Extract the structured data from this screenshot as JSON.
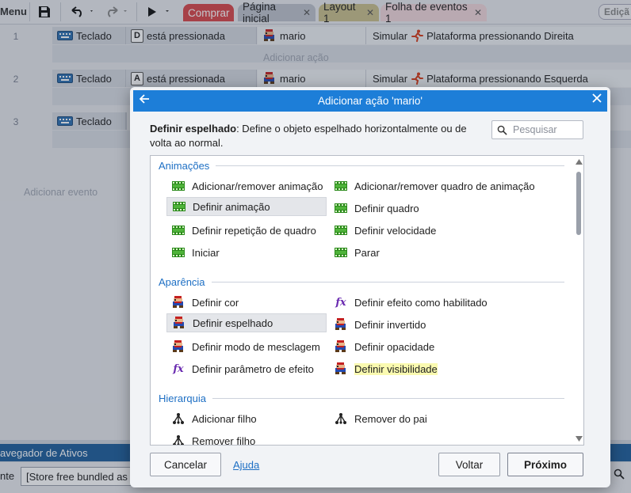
{
  "toolbar": {
    "menu_label": "Menu",
    "tabs": [
      {
        "label": "Comprar",
        "bg": "#d9474a",
        "fg": "#ffffff"
      },
      {
        "label": "Página inicial",
        "bg": "#bec3cc",
        "fg": "#1e1e1e"
      },
      {
        "label": "Layout 1",
        "bg": "#c9bf8c",
        "fg": "#1e1e1e"
      },
      {
        "label": "Folha de eventos 1",
        "bg": "#f1d7db",
        "fg": "#1e1e1e"
      }
    ],
    "edit_label": "Ediçã"
  },
  "events": [
    {
      "num": "1",
      "cond_object": "Teclado",
      "cond_key": "D",
      "cond_text": "está pressionada",
      "act_object": "mario",
      "act_text": "Simular",
      "act_detail": "Plataforma pressionando Direita",
      "add_action": "Adicionar ação"
    },
    {
      "num": "2",
      "cond_object": "Teclado",
      "cond_key": "A",
      "cond_text": "está pressionada",
      "act_object": "mario",
      "act_text": "Simular",
      "act_detail": "Plataforma pressionando Esquerda"
    },
    {
      "num": "3",
      "cond_object": "Teclado"
    }
  ],
  "add_event": "Adicionar evento",
  "bottom": {
    "panel_title": "avegador de Ativos",
    "left_label": "nte",
    "select_value": "[Store free bundled as"
  },
  "dialog": {
    "title": "Adicionar ação 'mario'",
    "desc_bold": "Definir espelhado",
    "desc_text": ": Define o objeto espelhado horizontalmente ou de volta ao normal.",
    "search_placeholder": "Pesquisar",
    "categories": {
      "animations": "Animações",
      "appearance": "Aparência",
      "hierarchy": "Hierarquia"
    },
    "items": {
      "a1": "Adicionar/remover animação",
      "a2": "Adicionar/remover quadro de animação",
      "a3": "Definir animação",
      "a4": "Definir quadro",
      "a5": "Definir repetição de quadro",
      "a6": "Definir velocidade",
      "a7": "Iniciar",
      "a8": "Parar",
      "p1": "Definir cor",
      "p2": "Definir efeito como habilitado",
      "p3": "Definir espelhado",
      "p4": "Definir invertido",
      "p5": "Definir modo de mesclagem",
      "p6": "Definir opacidade",
      "p7": "Definir parâmetro de efeito",
      "p8": "Definir visibilidade",
      "h1": "Adicionar filho",
      "h2": "Remover do pai",
      "h3": "Remover filho"
    },
    "buttons": {
      "cancel": "Cancelar",
      "help": "Ajuda",
      "back": "Voltar",
      "next": "Próximo"
    },
    "icon_fx": "fx"
  }
}
